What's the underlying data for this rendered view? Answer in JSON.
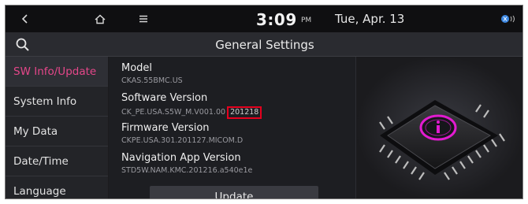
{
  "statusbar": {
    "time": "3:09",
    "ampm": "PM",
    "date": "Tue, Apr. 13"
  },
  "header": {
    "title": "General Settings"
  },
  "nav": {
    "items": [
      {
        "label": "SW Info/Update",
        "active": true
      },
      {
        "label": "System Info"
      },
      {
        "label": "My Data"
      },
      {
        "label": "Date/Time"
      },
      {
        "label": "Language"
      }
    ]
  },
  "list": {
    "rows": [
      {
        "title": "Model",
        "value": "CKAS.55BMC.US"
      },
      {
        "title": "Software Version",
        "value_prefix": "CK_PE.USA.S5W_M.V001.00",
        "value_highlight": "201218"
      },
      {
        "title": "Firmware Version",
        "value": "CKPE.USA.301.201127.MICOM.D"
      },
      {
        "title": "Navigation App Version",
        "value": "STD5W.NAM.KMC.201216.a540e1e"
      }
    ],
    "update_label": "Update"
  },
  "colors": {
    "accent": "#e5478a",
    "highlight_box": "#e5001e",
    "background": "#1b1b1e"
  },
  "icons": [
    "back-icon",
    "home-icon",
    "menu-icon",
    "search-icon",
    "connectivity-icon",
    "chip-info-icon"
  ]
}
